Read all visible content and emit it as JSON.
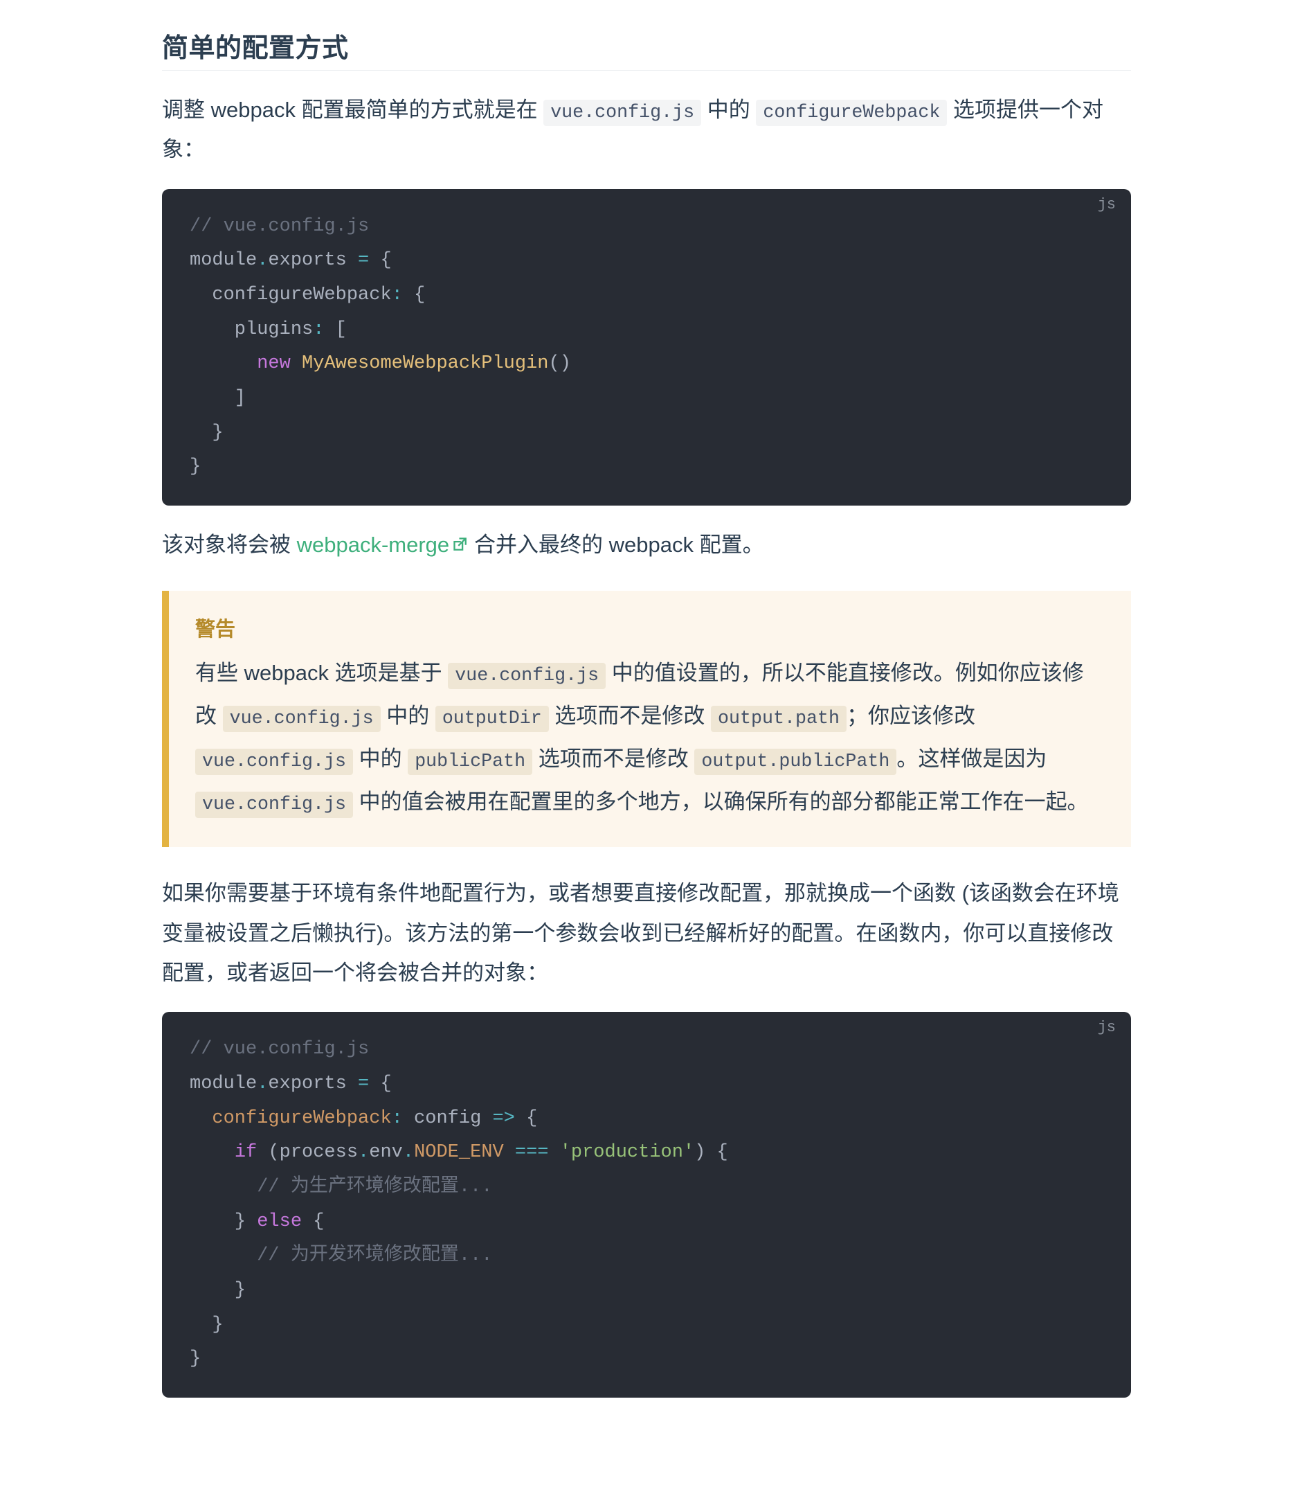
{
  "heading": "简单的配置方式",
  "p1": {
    "t1": "调整 webpack 配置最简单的方式就是在 ",
    "code1": "vue.config.js",
    "t2": " 中的 ",
    "code2": "configureWebpack",
    "t3": " 选项提供一个对象："
  },
  "code1": {
    "lang": "js",
    "l1": "// vue.config.js",
    "l2a": "module",
    "l2b": ".",
    "l2c": "exports ",
    "l2d": "=",
    "l2e": " {",
    "l3a": "  configureWebpack",
    "l3b": ":",
    "l3c": " {",
    "l4a": "    plugins",
    "l4b": ":",
    "l4c": " [",
    "l5a": "      ",
    "l5b": "new",
    "l5c": " ",
    "l5d": "MyAwesomeWebpackPlugin",
    "l5e": "()",
    "l6": "    ]",
    "l7": "  }",
    "l8": "}"
  },
  "p2": {
    "t1": "该对象将会被 ",
    "link_text": "webpack-merge",
    "t2": " 合并入最终的 webpack 配置。"
  },
  "warn": {
    "title": "警告",
    "t1": "有些 webpack 选项是基于 ",
    "c1": "vue.config.js",
    "t2": " 中的值设置的，所以不能直接修改。例如你应该修改 ",
    "c2": "vue.config.js",
    "t3": " 中的 ",
    "c3": "outputDir",
    "t4": " 选项而不是修改 ",
    "c4": "output.path",
    "t5": "；你应该修改 ",
    "c5": "vue.config.js",
    "t6": " 中的 ",
    "c6": "publicPath",
    "t7": " 选项而不是修改 ",
    "c7": "output.publicPath",
    "t8": "。这样做是因为 ",
    "c8": "vue.config.js",
    "t9": " 中的值会被用在配置里的多个地方，以确保所有的部分都能正常工作在一起。"
  },
  "p3": "如果你需要基于环境有条件地配置行为，或者想要直接修改配置，那就换成一个函数 (该函数会在环境变量被设置之后懒执行)。该方法的第一个参数会收到已经解析好的配置。在函数内，你可以直接修改配置，或者返回一个将会被合并的对象：",
  "code2": {
    "lang": "js",
    "l1": "// vue.config.js",
    "l2a": "module",
    "l2b": ".",
    "l2c": "exports ",
    "l2d": "=",
    "l2e": " {",
    "l3a": "  ",
    "l3b": "configureWebpack",
    "l3c": ":",
    "l3d": " config ",
    "l3e": "=>",
    "l3f": " {",
    "l4a": "    ",
    "l4b": "if",
    "l4c": " (process",
    "l4d": ".",
    "l4e": "env",
    "l4f": ".",
    "l4g": "NODE_ENV",
    "l4h": " ",
    "l4i": "===",
    "l4j": " ",
    "l4k": "'production'",
    "l4l": ") {",
    "l5": "      // 为生产环境修改配置...",
    "l6a": "    } ",
    "l6b": "else",
    "l6c": " {",
    "l7": "      // 为开发环境修改配置...",
    "l8": "    }",
    "l9": "  }",
    "l10": "}"
  }
}
